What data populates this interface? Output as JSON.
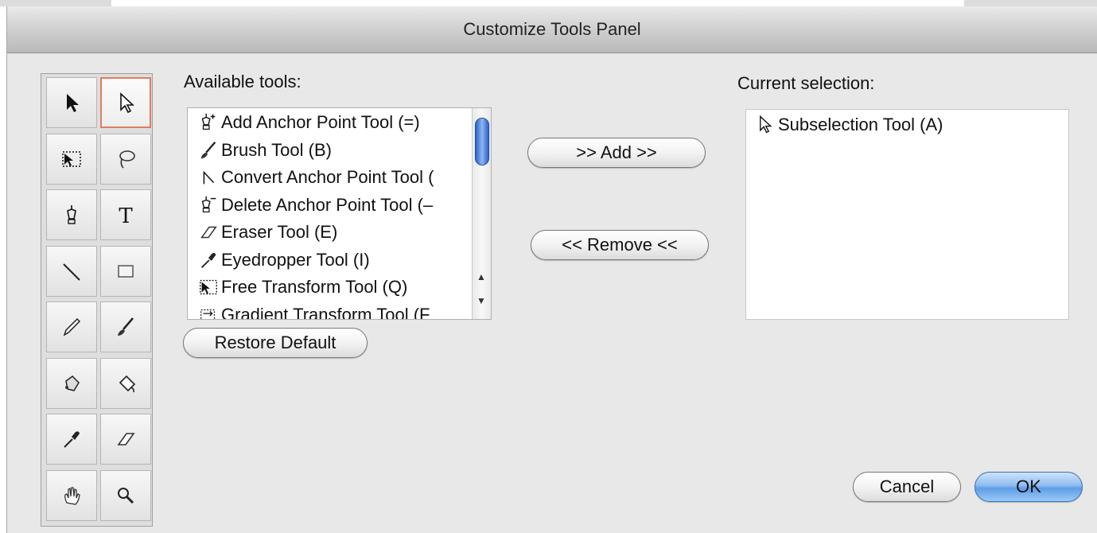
{
  "dialog": {
    "title": "Customize Tools Panel"
  },
  "tool_grid": [
    {
      "name": "selection-tool",
      "icon": "arrow-black-icon",
      "selected": false
    },
    {
      "name": "subselection-tool",
      "icon": "arrow-white-icon",
      "selected": true
    },
    {
      "name": "free-transform-tool",
      "icon": "free-transform-icon",
      "selected": false
    },
    {
      "name": "lasso-tool",
      "icon": "lasso-icon",
      "selected": false
    },
    {
      "name": "pen-tool",
      "icon": "pen-icon",
      "selected": false
    },
    {
      "name": "text-tool",
      "icon": "text-icon",
      "selected": false
    },
    {
      "name": "line-tool",
      "icon": "line-icon",
      "selected": false
    },
    {
      "name": "rectangle-tool",
      "icon": "rectangle-icon",
      "selected": false
    },
    {
      "name": "pencil-tool",
      "icon": "pencil-icon",
      "selected": false
    },
    {
      "name": "brush-tool",
      "icon": "brush-icon",
      "selected": false
    },
    {
      "name": "ink-bottle-tool",
      "icon": "ink-bottle-icon",
      "selected": false
    },
    {
      "name": "paint-bucket-tool",
      "icon": "paint-bucket-icon",
      "selected": false
    },
    {
      "name": "eyedropper-tool",
      "icon": "eyedropper-icon",
      "selected": false
    },
    {
      "name": "eraser-tool",
      "icon": "eraser-icon",
      "selected": false
    },
    {
      "name": "hand-tool",
      "icon": "hand-icon",
      "selected": false
    },
    {
      "name": "zoom-tool",
      "icon": "zoom-icon",
      "selected": false
    }
  ],
  "available": {
    "label": "Available tools:",
    "items": [
      {
        "text": "Add Anchor Point Tool (=)",
        "icon": "add-anchor-point-icon"
      },
      {
        "text": "Brush Tool (B)",
        "icon": "brush-icon"
      },
      {
        "text": "Convert Anchor Point Tool (",
        "icon": "convert-anchor-point-icon"
      },
      {
        "text": "Delete Anchor Point Tool (–",
        "icon": "delete-anchor-point-icon"
      },
      {
        "text": "Eraser Tool (E)",
        "icon": "eraser-icon"
      },
      {
        "text": "Eyedropper Tool (I)",
        "icon": "eyedropper-icon"
      },
      {
        "text": "Free Transform Tool (Q)",
        "icon": "free-transform-icon"
      },
      {
        "text": "Gradient Transform Tool (F",
        "icon": "gradient-transform-icon"
      }
    ]
  },
  "current": {
    "label": "Current selection:",
    "items": [
      {
        "text": "Subselection Tool (A)",
        "icon": "arrow-white-icon"
      }
    ]
  },
  "buttons": {
    "add": ">> Add >>",
    "remove": "<< Remove <<",
    "restore": "Restore Default",
    "cancel": "Cancel",
    "ok": "OK"
  },
  "colors": {
    "accent": "#5e9de6",
    "selected_border": "#e07d60"
  }
}
